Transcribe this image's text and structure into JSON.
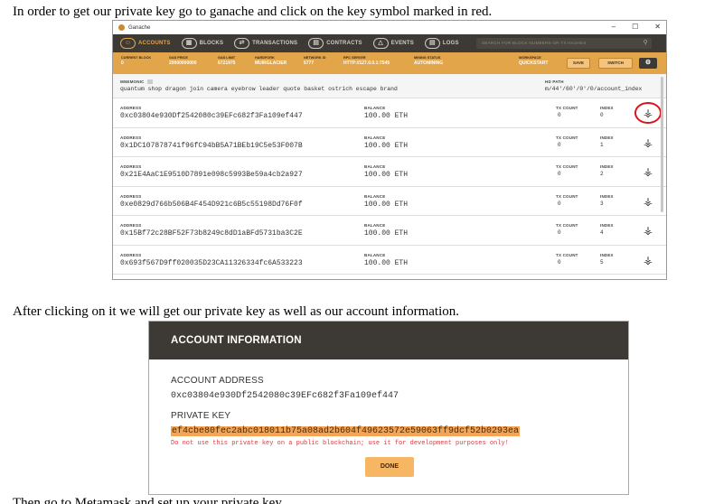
{
  "text": {
    "intro": "In order to get our private key go to ganache and click on the key symbol marked in red.",
    "after": "After clicking on it we will get our private key as well as our account information.",
    "next": "Then go to Metamask and set up your private key."
  },
  "ganache": {
    "title": "Ganache",
    "window_controls": [
      "–",
      "☐",
      "✕"
    ],
    "nav": [
      {
        "label": "ACCOUNTS",
        "icon": "accounts-icon",
        "active": true
      },
      {
        "label": "BLOCKS",
        "icon": "blocks-icon",
        "active": false
      },
      {
        "label": "TRANSACTIONS",
        "icon": "transactions-icon",
        "active": false
      },
      {
        "label": "CONTRACTS",
        "icon": "contracts-icon",
        "active": false
      },
      {
        "label": "EVENTS",
        "icon": "events-icon",
        "active": false
      },
      {
        "label": "LOGS",
        "icon": "logs-icon",
        "active": false
      }
    ],
    "search_placeholder": "SEARCH FOR BLOCK NUMBERS OR TX HASHES",
    "info": {
      "current_block": {
        "label": "CURRENT BLOCK",
        "value": "0"
      },
      "gas_price": {
        "label": "GAS PRICE",
        "value": "20000000000"
      },
      "gas_limit": {
        "label": "GAS LIMIT",
        "value": "6721975"
      },
      "hardfork": {
        "label": "HARDFORK",
        "value": "MUIRGLACIER"
      },
      "network_id": {
        "label": "NETWORK ID",
        "value": "5777"
      },
      "rpc_server": {
        "label": "RPC SERVER",
        "value": "HTTP://127.0.0.1:7545"
      },
      "mining_status": {
        "label": "MINING STATUS",
        "value": "AUTOMINING"
      },
      "workspace": {
        "label": "WORKSPACE",
        "value": "QUICKSTART"
      }
    },
    "buttons": {
      "save": "SAVE",
      "switch": "SWITCH"
    },
    "mnemonic": {
      "label": "MNEMONIC",
      "value": "quantum shop dragon join camera eyebrow leader quote basket ostrich escape brand"
    },
    "hd_path": {
      "label": "HD PATH",
      "value": "m/44'/60'/0'/0/account_index"
    },
    "column_labels": {
      "address": "ADDRESS",
      "balance": "BALANCE",
      "tx_count": "TX COUNT",
      "index": "INDEX"
    },
    "accounts": [
      {
        "address": "0xc03804e930Df2542080c39EFc682f3Fa109ef447",
        "balance": "100.00 ETH",
        "tx_count": "0",
        "index": "0"
      },
      {
        "address": "0x1DC107878741f96fC94bB5A71BEb19C5e53F007B",
        "balance": "100.00 ETH",
        "tx_count": "0",
        "index": "1"
      },
      {
        "address": "0x21E4AaC1E9510D7891e098c5993Be59a4cb2a927",
        "balance": "100.00 ETH",
        "tx_count": "0",
        "index": "2"
      },
      {
        "address": "0xe0829d766b506B4F454D921c6B5c55198Dd76F0f",
        "balance": "100.00 ETH",
        "tx_count": "0",
        "index": "3"
      },
      {
        "address": "0x15Bf72c28BF52F73b8249c8dD1aBFd5731ba3C2E",
        "balance": "100.00 ETH",
        "tx_count": "0",
        "index": "4"
      },
      {
        "address": "0x693f567D9ff020035D23CA11326334fc6A533223",
        "balance": "100.00 ETH",
        "tx_count": "0",
        "index": "5"
      }
    ],
    "highlight_color": "#d8151b",
    "accent_color": "#e3a54a"
  },
  "modal": {
    "title": "ACCOUNT INFORMATION",
    "address_label": "ACCOUNT ADDRESS",
    "address": "0xc03804e930Df2542080c39EFc682f3Fa109ef447",
    "private_key_label": "PRIVATE KEY",
    "private_key": "ef4cbe80fec2abc018011b75a08ad2b604f49623572e59063ff9dcf52b0293ea",
    "warning": "Do not use this private key on a public blockchain; use it for development purposes only!",
    "done": "DONE"
  }
}
